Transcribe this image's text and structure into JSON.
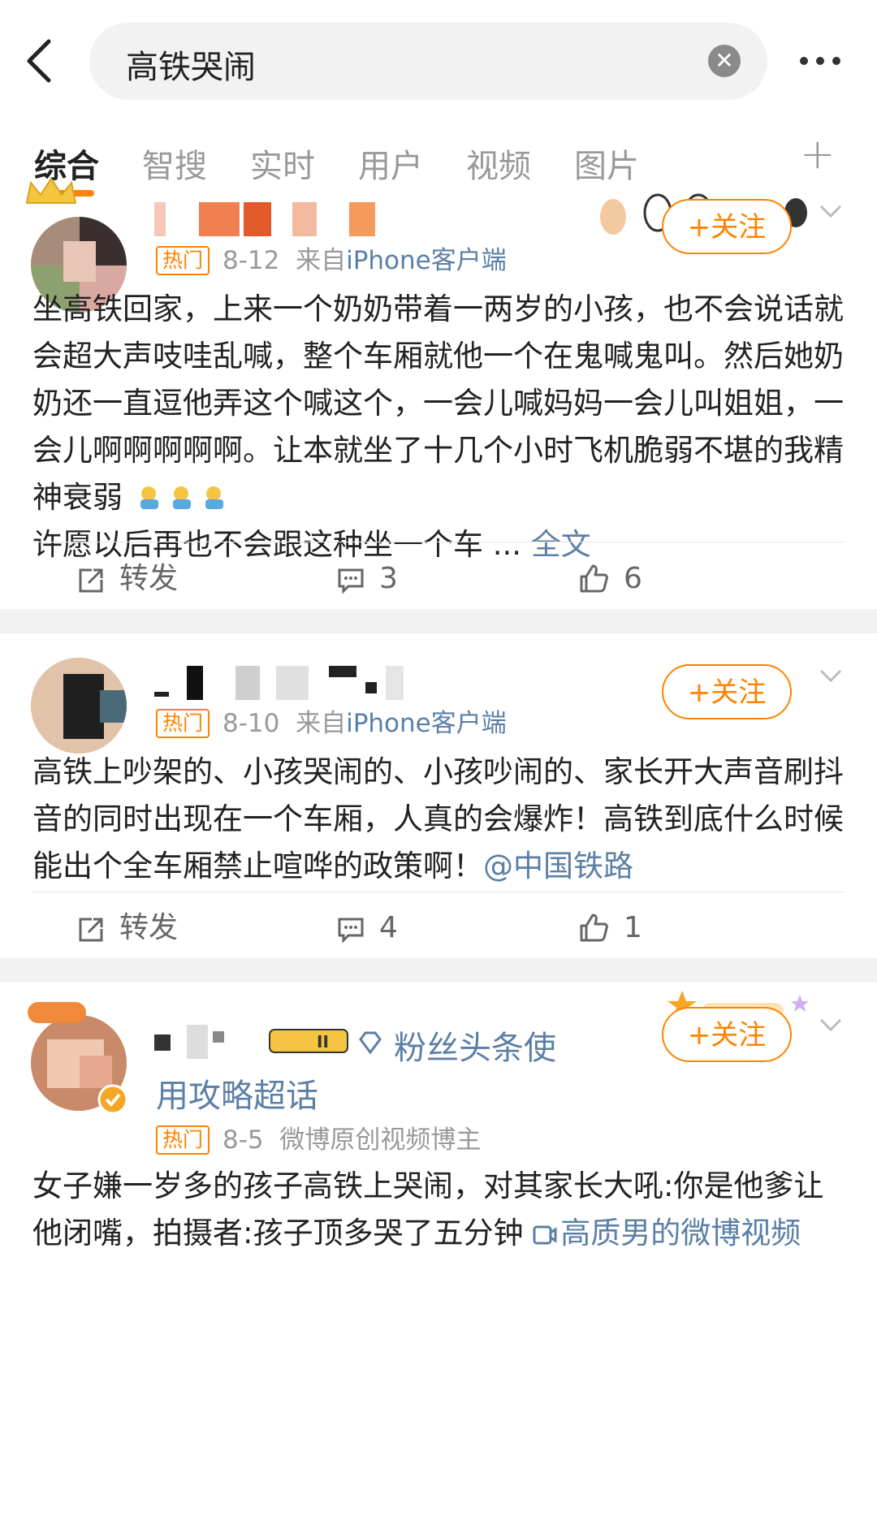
{
  "search": {
    "query": "高铁哭闹",
    "clear_label": "✕"
  },
  "tabs": [
    {
      "label": "综合",
      "active": true
    },
    {
      "label": "智搜"
    },
    {
      "label": "实时"
    },
    {
      "label": "用户"
    },
    {
      "label": "视频"
    },
    {
      "label": "图片"
    }
  ],
  "tabs_more": "+",
  "accent_color": "#ff8200",
  "link_color": "#5b7fa6",
  "posts": [
    {
      "follow_label": "+关注",
      "badge": "热门",
      "date": "8-12",
      "from": "来自",
      "source": "iPhone客户端",
      "text": "坐高铁回家，上来一个奶奶带着一两岁的小孩，也不会说话就会超大声吱哇乱喊，整个车厢就他一个在鬼喊鬼叫。然后她奶奶还一直逗他弄这个喊这个，一会儿喊妈妈一会儿叫姐姐，一会儿啊啊啊啊啊。让本就坐了十几个小时飞机脆弱不堪的我精神衰弱",
      "text2": "许愿以后再也不会跟这种坐一个车 ...",
      "more_link": "全文",
      "repost_label": "转发",
      "comments": "3",
      "likes": "6"
    },
    {
      "follow_label": "+关注",
      "badge": "热门",
      "date": "8-10",
      "from": "来自",
      "source": "iPhone客户端",
      "text": "高铁上吵架的、小孩哭闹的、小孩吵闹的、家长开大声音刷抖音的同时出现在一个车厢，人真的会爆炸！高铁到底什么时候能出个全车厢禁止喧哗的政策啊！",
      "mention": "@中国铁路",
      "repost_label": "转发",
      "comments": "4",
      "likes": "1"
    },
    {
      "follow_label": "+关注",
      "badge": "热门",
      "date": "8-5",
      "source_plain": "微博原创视频博主",
      "fan_badge_level": "II",
      "fan_title": "粉丝头条使",
      "topic_line": "用攻略超话",
      "text": "女子嫌一岁多的孩子高铁上哭闹，对其家长大吼:你是他爹让他闭嘴，拍摄者:孩子顶多哭了五分钟",
      "video_link": "高质男的微博视频"
    }
  ]
}
